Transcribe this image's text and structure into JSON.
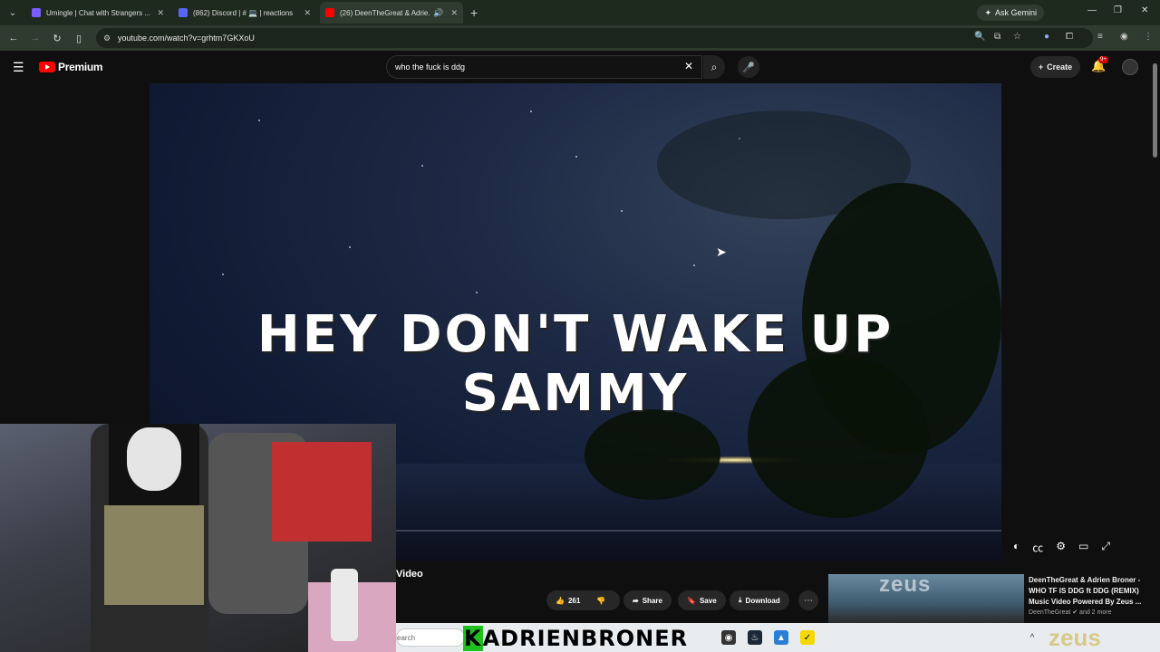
{
  "browser": {
    "tabs": [
      {
        "title": "Umingle | Chat with Strangers ...",
        "fav_color": "#7b5cff",
        "active": false
      },
      {
        "title": "(862) Discord | # 💻 | reactions",
        "fav_color": "#5865f2",
        "active": false
      },
      {
        "title": "(26) DeenTheGreat & Adrie...",
        "fav_color": "#ff0000",
        "active": true
      }
    ],
    "new_tab": "+",
    "ask_gemini": "Ask Gemini",
    "url": "youtube.com/watch?v=grhtm7GKXoU"
  },
  "youtube": {
    "logo_text": "Premium",
    "search_value": "who the fuck is ddg",
    "create_label": "Create",
    "notification_count": "9+"
  },
  "video": {
    "caption": "HEY DON'T WAKE UP SAMMY",
    "title_fragment": "Video",
    "like_count": "261",
    "share_label": "Share",
    "save_label": "Save",
    "download_label": "Download"
  },
  "recommended": {
    "thumb_text": "zeus",
    "title": "DeenTheGreat & Adrien Broner - WHO TF IS DDG ft DDG (REMIX) Music Video Powered By Zeus ...",
    "channel": "DeenTheGreat ✔ and 2 more"
  },
  "taskbar": {
    "search_placeholder": "earch",
    "streamer_k": "K",
    "streamer_name": "ADRIENBRONER",
    "zeus": "zeus"
  },
  "colors": {
    "youtube_red": "#ff0000",
    "browser_frame": "#1f2a1f",
    "page_bg": "#0f0f0f"
  }
}
